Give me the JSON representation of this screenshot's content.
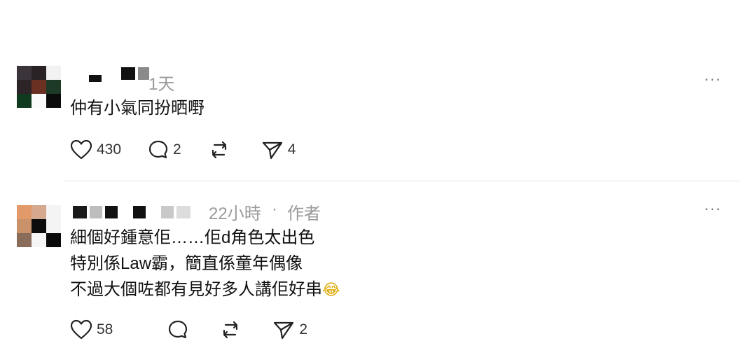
{
  "comments": [
    {
      "time": "1天",
      "author_tag": "",
      "lines": [
        "仲有小氣同扮晒嘢"
      ],
      "likes": "430",
      "replies": "2",
      "reposts": "",
      "shares": "4",
      "more_label": "···"
    },
    {
      "time": "22小時",
      "separator": "·",
      "author_tag": "作者",
      "lines": [
        "細個好鍾意佢……佢d角色太出色",
        "特別係Law霸，簡直係童年偶像",
        "不過大個咗都有見好多人講佢好串"
      ],
      "emoji": "😂",
      "likes": "58",
      "replies": "",
      "reposts": "",
      "shares": "2",
      "more_label": "···"
    }
  ],
  "icons": {
    "like": "heart-icon",
    "reply": "comment-icon",
    "repost": "repost-icon",
    "share": "send-icon",
    "more": "more-icon"
  }
}
